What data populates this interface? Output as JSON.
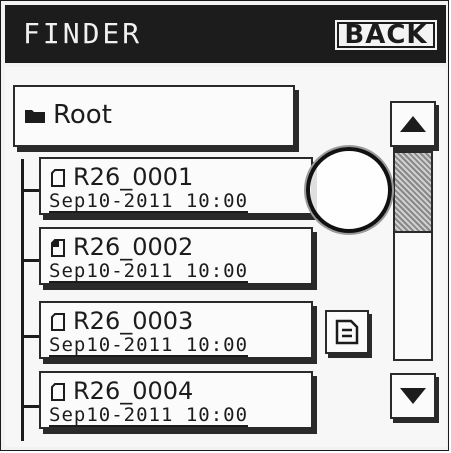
{
  "header": {
    "title": "FINDER",
    "back_label": "BACK"
  },
  "root": {
    "label": "Root",
    "icon": "folder-icon"
  },
  "files": [
    {
      "name": "R26_0001",
      "date": "Sep10-2011  10:00",
      "icon": "file-icon",
      "selected": false
    },
    {
      "name": "R26_0002",
      "date": "Sep10-2011  10:00",
      "icon": "file-active-icon",
      "selected": false
    },
    {
      "name": "R26_0003",
      "date": "Sep10-2011  10:00",
      "icon": "file-icon",
      "selected": false
    },
    {
      "name": "R26_0004",
      "date": "Sep10-2011  10:00",
      "icon": "file-icon",
      "selected": false
    }
  ],
  "scroll": {
    "position_fraction": 0.0
  },
  "colors": {
    "header_bg": "#1c1c1c",
    "panel_bg": "#f7f7f7",
    "ink": "#1c1c1c"
  }
}
